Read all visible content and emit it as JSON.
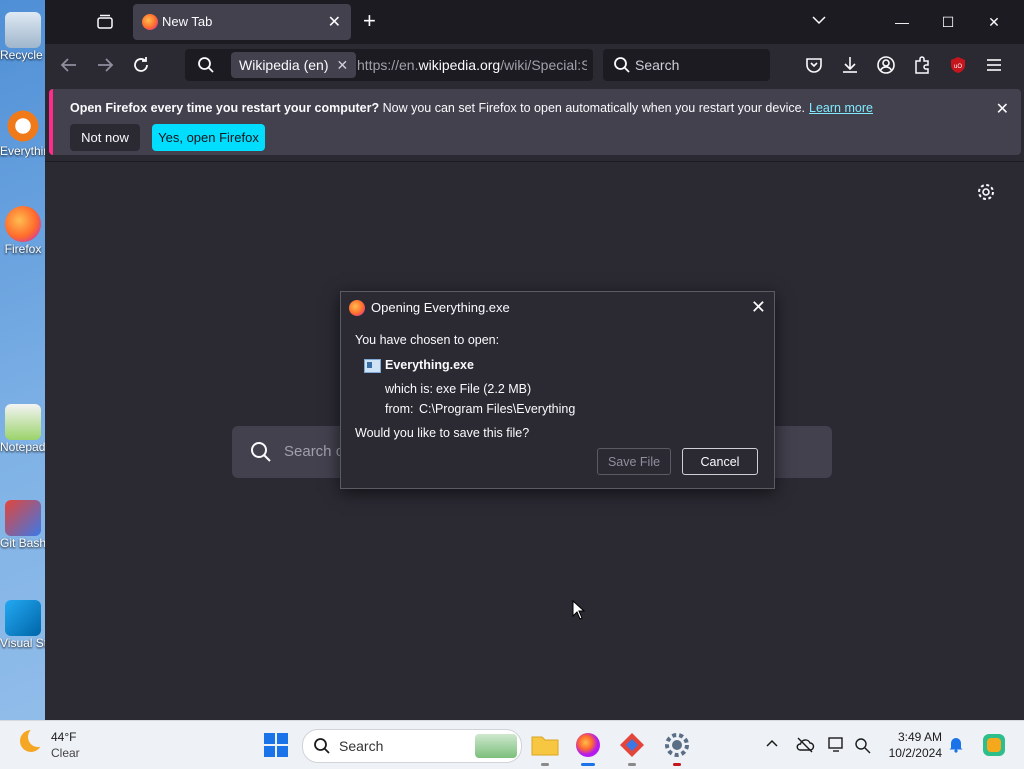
{
  "desktop": {
    "icons": [
      {
        "label": "Recycle Bin"
      },
      {
        "label": "Everything"
      },
      {
        "label": "Firefox"
      },
      {
        "label": "Notepad++"
      },
      {
        "label": "Git Bash"
      },
      {
        "label": "Visual Studio Code"
      }
    ]
  },
  "browser": {
    "tab": {
      "title": "New Tab"
    },
    "urlbar": {
      "engine": "Wikipedia (en)",
      "url_prefix": "https://en.",
      "url_domain": "wikipedia.org",
      "url_suffix": "/wiki/Special:S"
    },
    "searchbar": {
      "placeholder": "Search"
    },
    "notification": {
      "bold": "Open Firefox every time you restart your computer?",
      "text": " Now you can set Firefox to open automatically when you restart your device.",
      "link": "Learn more",
      "not_now": "Not now",
      "yes": "Yes, open Firefox"
    },
    "newtab": {
      "search_placeholder": "Search or enter address"
    }
  },
  "dialog": {
    "title": "Opening Everything.exe",
    "chosen": "You have chosen to open:",
    "filename": "Everything.exe",
    "which_is_label": "which is:",
    "which_is_value": "exe File (2.2 MB)",
    "from_label": "from:",
    "from_value": "C:\\Program Files\\Everything",
    "question": "Would you like to save this file?",
    "save": "Save File",
    "cancel": "Cancel"
  },
  "taskbar": {
    "weather_temp": "44°F",
    "weather_cond": "Clear",
    "search_placeholder": "Search",
    "time": "3:49 AM",
    "date": "10/2/2024"
  },
  "colors": {
    "accent": "#00ddff",
    "notification_stripe": "#ff2a8a",
    "browser_bg": "#2b2a33"
  }
}
